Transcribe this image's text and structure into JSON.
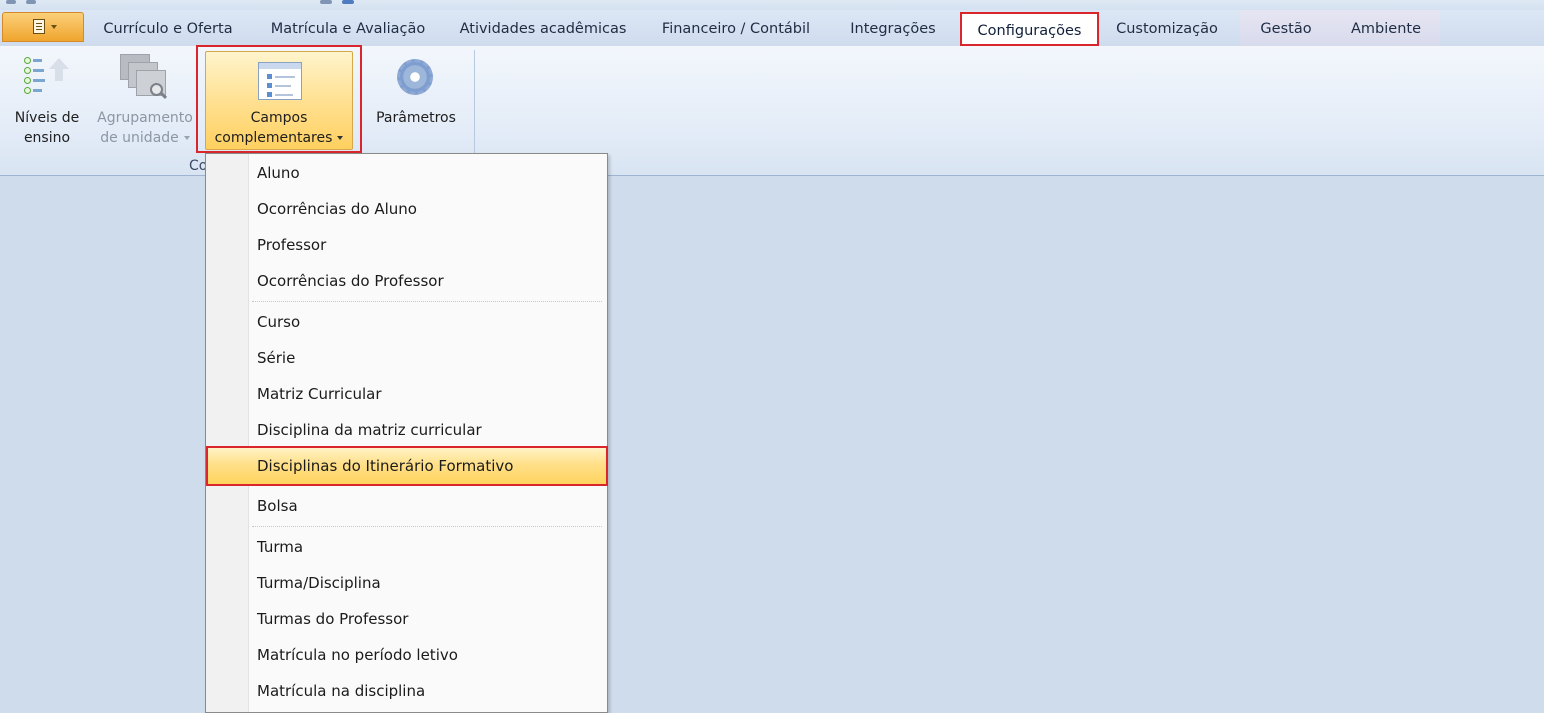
{
  "tabs": [
    {
      "label": "Currículo e Oferta"
    },
    {
      "label": "Matrícula e Avaliação"
    },
    {
      "label": "Atividades acadêmicas"
    },
    {
      "label": "Financeiro / Contábil"
    },
    {
      "label": "Integrações"
    },
    {
      "label": "Configurações"
    },
    {
      "label": "Customização"
    },
    {
      "label": "Gestão"
    },
    {
      "label": "Ambiente"
    }
  ],
  "ribbon": {
    "niveis": {
      "line1": "Níveis de",
      "line2": "ensino",
      "icon": "levels-icon"
    },
    "agrupamento": {
      "line1": "Agrupamento",
      "line2": "de unidade",
      "icon": "grouping-icon"
    },
    "campos": {
      "line1": "Campos",
      "line2": "complementares",
      "icon": "form-fields-icon"
    },
    "parametros": {
      "label": "Parâmetros",
      "icon": "gear-icon"
    },
    "group_label": "Co"
  },
  "menu": {
    "items": [
      "Aluno",
      "Ocorrências do Aluno",
      "Professor",
      "Ocorrências do Professor",
      "Curso",
      "Série",
      "Matriz Curricular",
      "Disciplina da matriz curricular",
      "Disciplinas do Itinerário Formativo",
      "Bolsa",
      "Turma",
      "Turma/Disciplina",
      "Turmas do Professor",
      "Matrícula no período letivo",
      "Matrícula na disciplina"
    ],
    "highlighted": "Disciplinas do Itinerário Formativo"
  },
  "colors": {
    "accent_highlight": "#d9262c",
    "ribbon_bg": "#e2ebf7",
    "workspace_bg": "#cfdcec",
    "menu_hover": "#ffe089"
  }
}
